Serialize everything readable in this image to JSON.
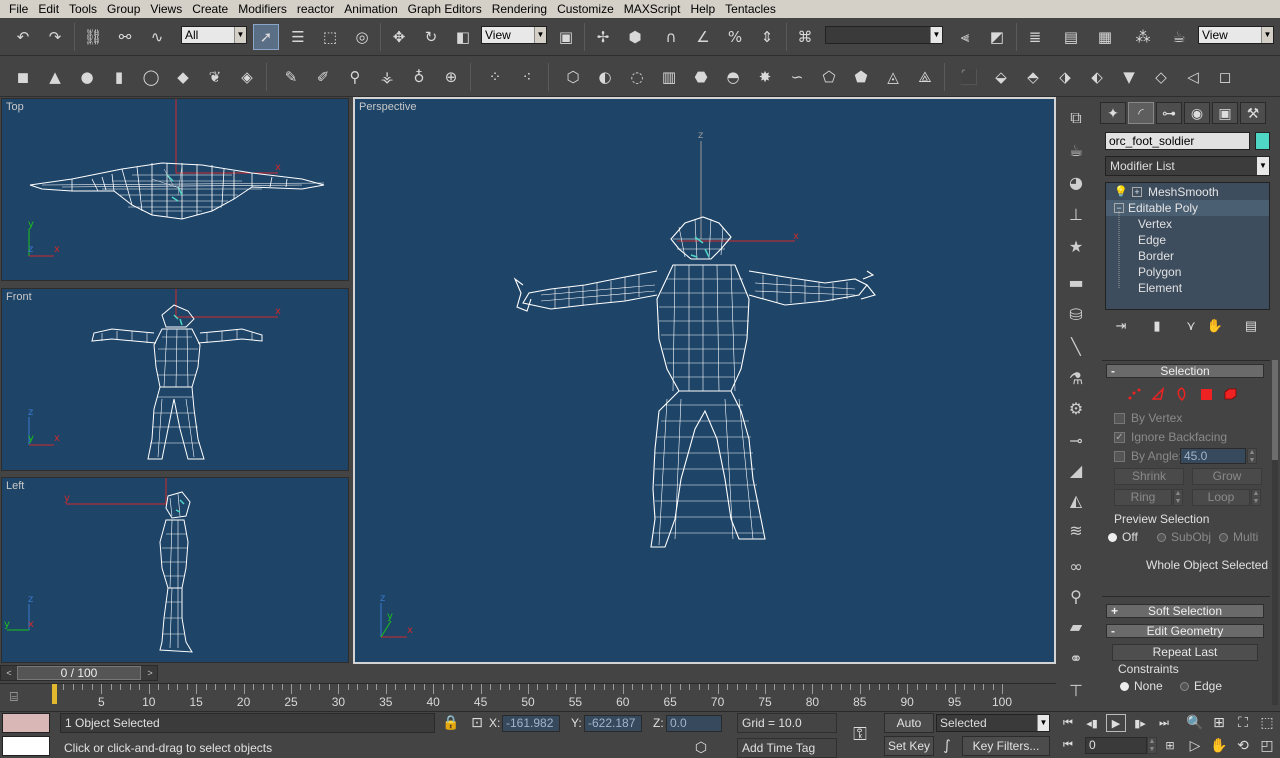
{
  "menu": [
    "File",
    "Edit",
    "Tools",
    "Group",
    "Views",
    "Create",
    "Modifiers",
    "reactor",
    "Animation",
    "Graph Editors",
    "Rendering",
    "Customize",
    "MAXScript",
    "Help",
    "Tentacles"
  ],
  "toolbar": {
    "selection_filter": "All",
    "ref_coord": "View",
    "named_selection": "",
    "view_right": "View"
  },
  "viewports": {
    "top": "Top",
    "front": "Front",
    "left": "Left",
    "perspective": "Perspective"
  },
  "axes": {
    "x": "x",
    "y": "y",
    "z": "z"
  },
  "command_panel": {
    "object_name": "orc_foot_soldier",
    "object_color": "#4fd6c4",
    "modifier_list": "Modifier List",
    "stack": {
      "meshsmooth": "MeshSmooth",
      "editable_poly": "Editable Poly",
      "sub": [
        "Vertex",
        "Edge",
        "Border",
        "Polygon",
        "Element"
      ]
    },
    "selection": {
      "title": "Selection",
      "collapse_sign": "-",
      "by_vertex": "By Vertex",
      "ignore_backfacing": "Ignore Backfacing",
      "by_angle": "By Angle:",
      "angle_value": "45.0",
      "shrink": "Shrink",
      "grow": "Grow",
      "ring": "Ring",
      "loop": "Loop",
      "preview_selection": "Preview Selection",
      "off": "Off",
      "subobj": "SubObj",
      "multi": "Multi",
      "whole_object": "Whole Object Selected"
    },
    "soft_selection": {
      "title": "Soft Selection",
      "sign": "+"
    },
    "edit_geometry": {
      "title": "Edit Geometry",
      "sign": "-",
      "repeat_last": "Repeat Last",
      "constraints": "Constraints",
      "none": "None",
      "edge": "Edge"
    }
  },
  "timeline": {
    "slider_label": "0 / 100",
    "slider_left": "<",
    "slider_right": ">",
    "ticks": [
      5,
      10,
      15,
      20,
      25,
      30,
      35,
      40,
      45,
      50,
      55,
      60,
      65,
      70,
      75,
      80,
      85,
      90,
      95,
      100
    ],
    "max_frame": 100,
    "current_frame": 0
  },
  "status": {
    "selected_count": "1 Object Selected",
    "prompt": "Click or click-and-drag to select objects",
    "x_label": "X:",
    "x_value": "-161.982",
    "y_label": "Y:",
    "y_value": "-622.187",
    "z_label": "Z:",
    "z_value": "0.0",
    "grid": "Grid = 10.0",
    "add_time_tag": "Add Time Tag",
    "auto_key": "Auto Key",
    "set_key": "Set Key",
    "key_mode": "Selected",
    "key_filters": "Key Filters...",
    "frame_field": "0"
  }
}
